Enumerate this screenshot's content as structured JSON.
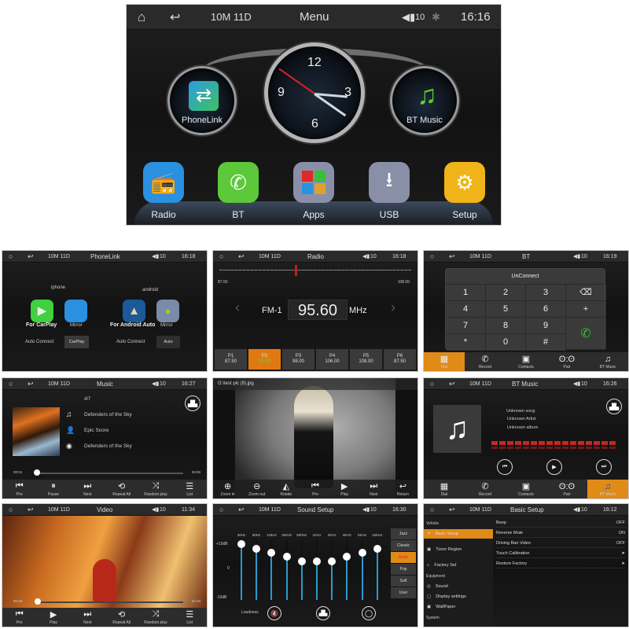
{
  "main_menu": {
    "status": {
      "date": "10M 11D",
      "title": "Menu",
      "volume": "10",
      "time": "16:16"
    },
    "widgets": [
      {
        "label": "PhoneLink",
        "icon": "phonelink-icon"
      },
      {
        "label": "BT Music",
        "icon": "bt-music-icon"
      }
    ],
    "clock": {
      "numerals": [
        "12",
        "3",
        "6",
        "9"
      ]
    },
    "apps": [
      {
        "label": "Radio",
        "icon": "radio-icon",
        "color": "#2a90e0"
      },
      {
        "label": "BT",
        "icon": "phone-icon",
        "color": "#5cc83a"
      },
      {
        "label": "Apps",
        "icon": "apps-grid-icon",
        "color": "#8a8fa8"
      },
      {
        "label": "USB",
        "icon": "usb-icon",
        "color": "#8a8fa8"
      },
      {
        "label": "Setup",
        "icon": "gear-icon",
        "color": "#f0b418"
      }
    ]
  },
  "phonelink": {
    "status": {
      "date": "10M 11D",
      "title": "PhoneLink",
      "volume": "10",
      "time": "16:18"
    },
    "iphone_label": "iphone",
    "android_label": "android",
    "carplay_label": "For CarPlay",
    "mirror_label": "Mirror",
    "android_auto_label": "For Android Auto",
    "android_mirror_label": "Mirror",
    "auto_connect_label": "Auto Connect",
    "auto_connect_iphone_value": "CarPlay",
    "auto_connect_android_label": "Auto Connect",
    "auto_connect_android_value": "Auto"
  },
  "radio": {
    "status": {
      "date": "10M 11D",
      "title": "Radio",
      "volume": "10",
      "time": "16:18"
    },
    "range_min": "87.50",
    "range_max": "108.00",
    "band": "FM-1",
    "frequency": "95.60",
    "unit": "MHz",
    "tuner_position": 0.39,
    "presets": [
      {
        "label": "P1",
        "freq": "87.50",
        "active": false
      },
      {
        "label": "P2",
        "freq": "90.00",
        "active": true
      },
      {
        "label": "P3",
        "freq": "98.00",
        "active": false
      },
      {
        "label": "P4",
        "freq": "106.00",
        "active": false
      },
      {
        "label": "P5",
        "freq": "108.00",
        "active": false
      },
      {
        "label": "P6",
        "freq": "87.50",
        "active": false
      }
    ]
  },
  "bt_dial": {
    "status": {
      "date": "10M 11D",
      "title": "BT",
      "volume": "10",
      "time": "16:19"
    },
    "connection": "UnConnect",
    "keys": [
      "1",
      "2",
      "3",
      "4",
      "5",
      "6",
      "7",
      "8",
      "9",
      "*",
      "0",
      "#"
    ],
    "side_keys": {
      "backspace": "⌫",
      "plus": "+",
      "call": "✆"
    },
    "tabs": [
      {
        "label": "Dial",
        "icon": "dialpad-icon",
        "active": true
      },
      {
        "label": "Record",
        "icon": "call-log-icon",
        "active": false
      },
      {
        "label": "Contacts",
        "icon": "contacts-icon",
        "active": false
      },
      {
        "label": "Pair",
        "icon": "pair-icon",
        "active": false
      },
      {
        "label": "BT Music",
        "icon": "music-note-icon",
        "active": false
      }
    ]
  },
  "music": {
    "status": {
      "date": "10M 11D",
      "title": "Music",
      "volume": "10",
      "time": "16:27"
    },
    "track_index": "4/7",
    "song": "Defenders of the Sky",
    "artist": "Epic Score",
    "album": "Defenders of the Sky",
    "elapsed": "00:01",
    "duration": "04:00",
    "progress": 0.01,
    "controls": [
      {
        "label": "Pre",
        "icon": "previous-icon"
      },
      {
        "label": "Pause",
        "icon": "pause-icon"
      },
      {
        "label": "Next",
        "icon": "next-icon"
      },
      {
        "label": "Repeat All",
        "icon": "repeat-icon"
      },
      {
        "label": "Random play",
        "icon": "shuffle-icon"
      },
      {
        "label": "List",
        "icon": "list-icon"
      }
    ]
  },
  "photo": {
    "filename": "G:\\test pic (9).jpg",
    "controls": [
      {
        "label": "Zoom in",
        "icon": "zoom-in-icon"
      },
      {
        "label": "Zoom out",
        "icon": "zoom-out-icon"
      },
      {
        "label": "Rotate",
        "icon": "rotate-icon"
      },
      {
        "label": "Pre",
        "icon": "previous-icon"
      },
      {
        "label": "Play",
        "icon": "play-icon"
      },
      {
        "label": "Next",
        "icon": "next-icon"
      },
      {
        "label": "Return",
        "icon": "return-icon"
      }
    ]
  },
  "bt_music": {
    "status": {
      "date": "10M 11D",
      "title": "BT Music",
      "volume": "10",
      "time": "16:26"
    },
    "song": "Unknown song",
    "artist": "Unknown Artist",
    "album": "Unknown album",
    "tabs": [
      {
        "label": "Dial",
        "icon": "dialpad-icon",
        "active": false
      },
      {
        "label": "Record",
        "icon": "call-log-icon",
        "active": false
      },
      {
        "label": "Contacts",
        "icon": "contacts-icon",
        "active": false
      },
      {
        "label": "Pair",
        "icon": "pair-icon",
        "active": false
      },
      {
        "label": "BT Music",
        "icon": "music-note-icon",
        "active": true
      }
    ]
  },
  "video": {
    "status": {
      "date": "10M 11D",
      "title": "Video",
      "volume": "10",
      "time": "11:34"
    },
    "elapsed": "00:00",
    "duration": "02:20",
    "progress": 0.0,
    "controls": [
      {
        "label": "Pre",
        "icon": "previous-icon"
      },
      {
        "label": "Play",
        "icon": "play-icon"
      },
      {
        "label": "Next",
        "icon": "next-icon"
      },
      {
        "label": "Repeat All",
        "icon": "repeat-icon"
      },
      {
        "label": "Random play",
        "icon": "shuffle-icon"
      },
      {
        "label": "List",
        "icon": "list-icon"
      }
    ]
  },
  "sound": {
    "status": {
      "date": "10M 11D",
      "title": "Sound Setup",
      "volume": "10",
      "time": "16:30"
    },
    "db_top": "+10dB",
    "db_mid": "0",
    "db_bottom": "-10dB",
    "bands": [
      {
        "label": "30Hz",
        "level": 0.93
      },
      {
        "label": "60Hz",
        "level": 0.86
      },
      {
        "label": "125Hz",
        "level": 0.79
      },
      {
        "label": "250Hz",
        "level": 0.72
      },
      {
        "label": "500Hz",
        "level": 0.65
      },
      {
        "label": "1KHz",
        "level": 0.65
      },
      {
        "label": "2KHz",
        "level": 0.65
      },
      {
        "label": "4KHz",
        "level": 0.72
      },
      {
        "label": "8KHz",
        "level": 0.79
      },
      {
        "label": "16KHz",
        "level": 0.86
      }
    ],
    "presets": [
      {
        "label": "Jazz",
        "active": false
      },
      {
        "label": "Classic",
        "active": false
      },
      {
        "label": "Rock",
        "active": true
      },
      {
        "label": "Pop",
        "active": false
      },
      {
        "label": "Soft",
        "active": false
      },
      {
        "label": "User",
        "active": false
      }
    ],
    "loudness_label": "Loudness"
  },
  "basic_setup": {
    "status": {
      "date": "10M 11D",
      "title": "Basic Setup",
      "volume": "10",
      "time": "16:12"
    },
    "sections": {
      "vehicle": "Vehicle",
      "equipment": "Equipment",
      "system": "System"
    },
    "menu": [
      {
        "label": "Basic Setup",
        "icon": "wrench-icon",
        "active": true
      },
      {
        "label": "Tuner Region",
        "icon": "radio-icon",
        "active": false
      },
      {
        "label": "Factory Set",
        "icon": "factory-icon",
        "active": false
      },
      {
        "label": "Sound",
        "icon": "sound-icon",
        "active": false
      },
      {
        "label": "Display settings",
        "icon": "display-icon",
        "active": false
      },
      {
        "label": "WallPaper",
        "icon": "wallpaper-icon",
        "active": false
      }
    ],
    "settings": [
      {
        "label": "Beep",
        "value": "OFF"
      },
      {
        "label": "Reverse Mute",
        "value": "ON"
      },
      {
        "label": "Driving Ban Video",
        "value": "OFF"
      },
      {
        "label": "Touch Calibration",
        "value": "➤"
      },
      {
        "label": "Restore Factory",
        "value": "➤"
      }
    ]
  }
}
